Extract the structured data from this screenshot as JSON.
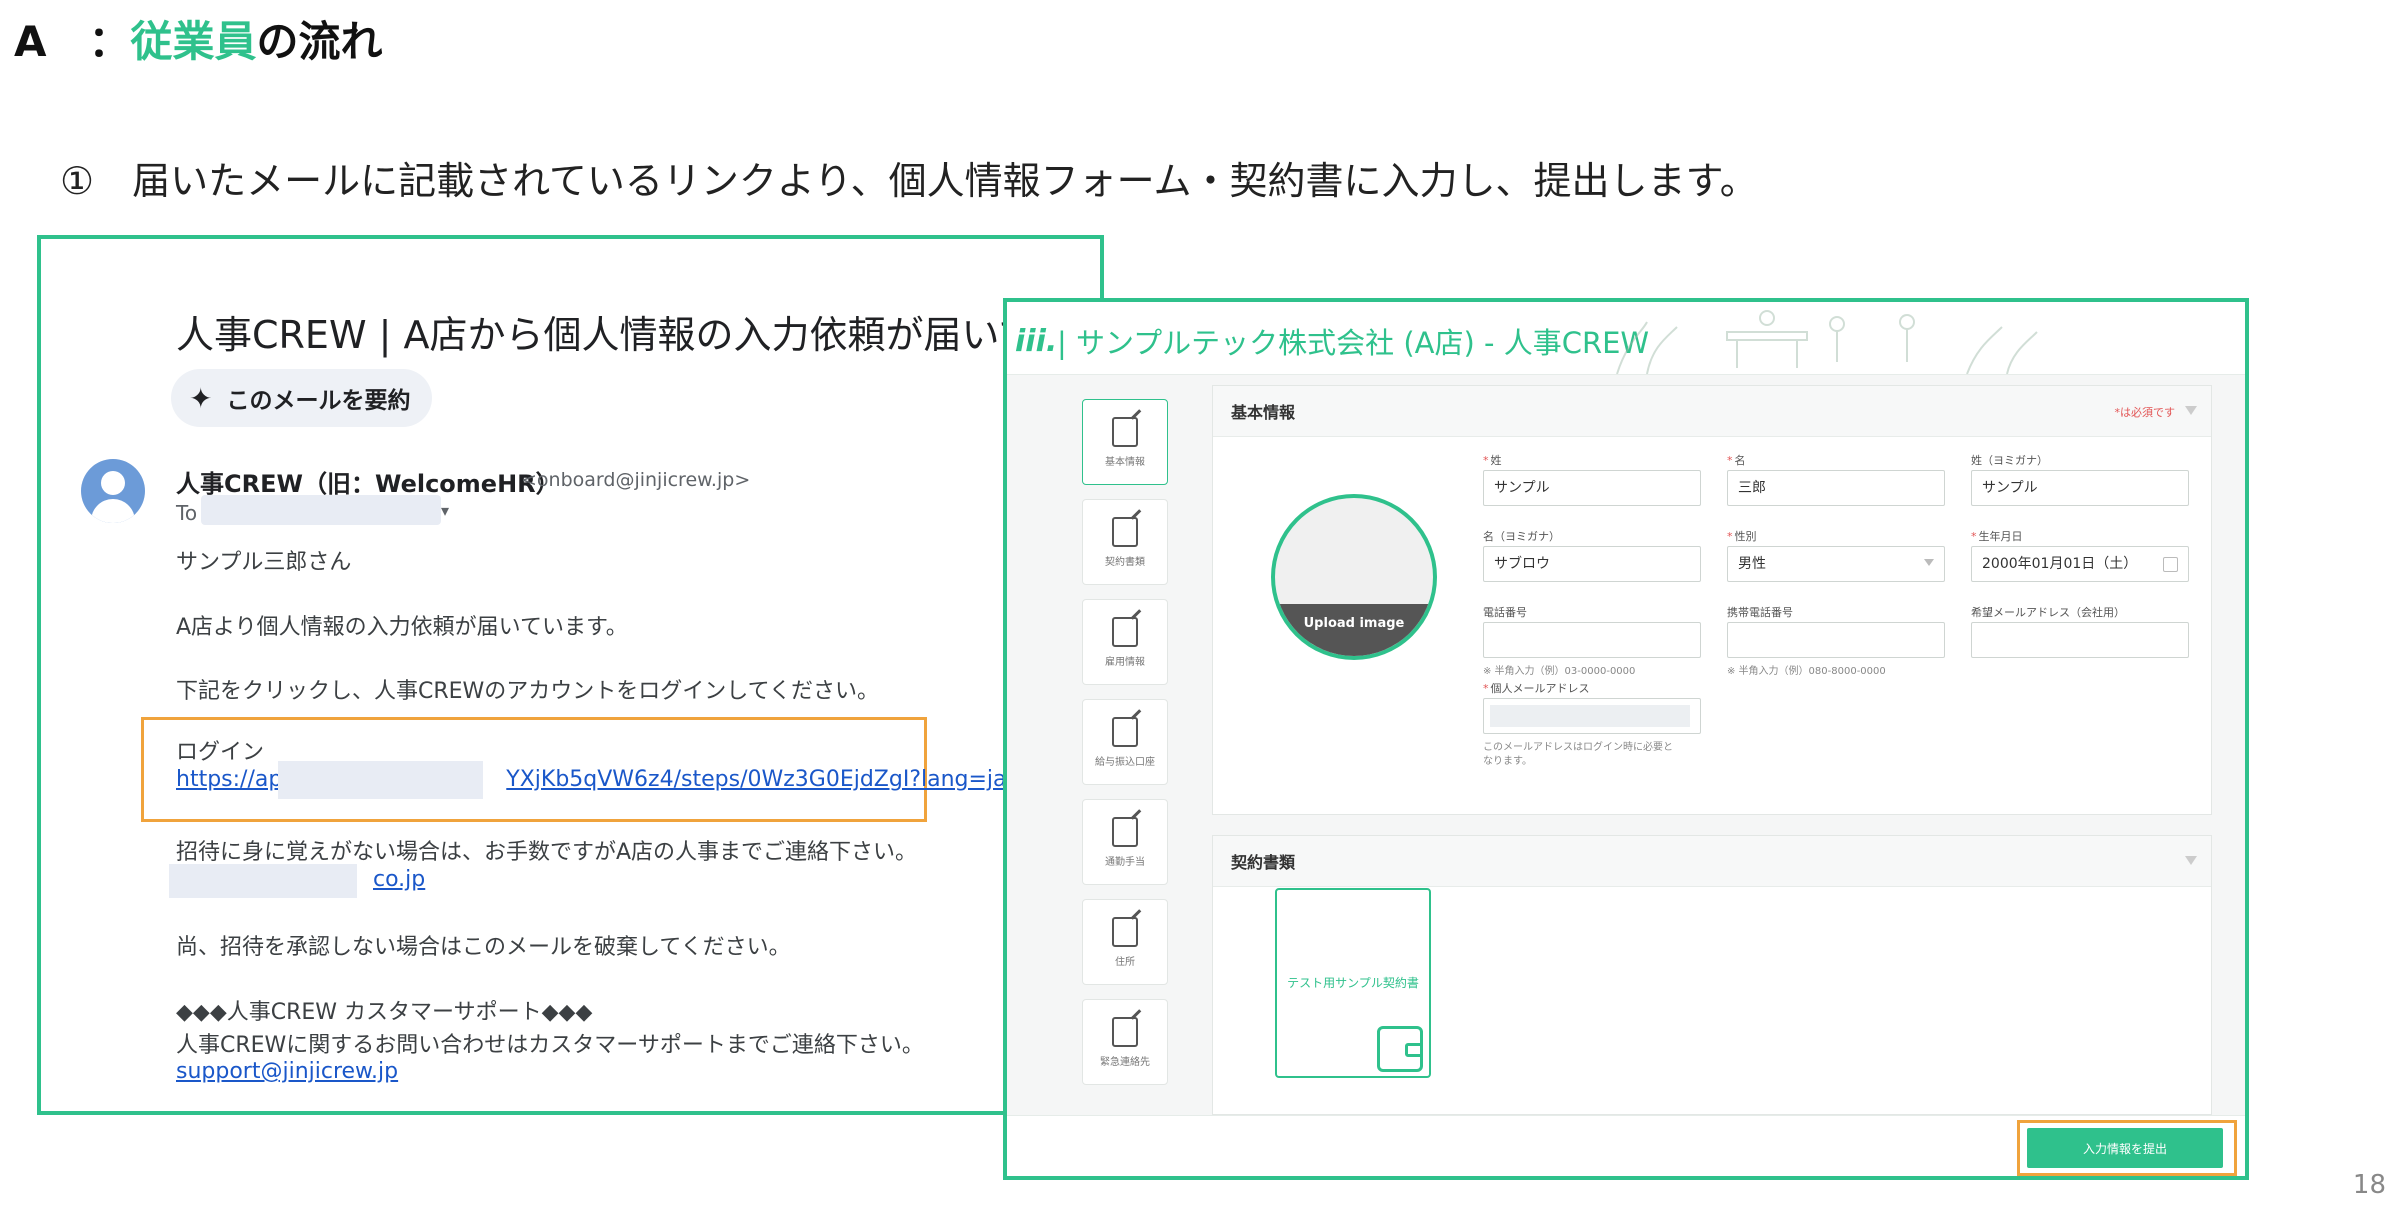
{
  "slide": {
    "title_prefix": "A　：",
    "title_highlight": "従業員",
    "title_suffix": "の流れ",
    "step_text": "①　届いたメールに記載されているリンクより、個人情報フォーム・契約書に入力し、提出します。",
    "page_number": "18"
  },
  "email": {
    "subject": "人事CREW | A店から個人情報の入力依頼が届いています",
    "summarize_label": "このメールを要約",
    "sender_name": "人事CREW（旧：WelcomeHR）",
    "sender_address": "<onboard@jinjicrew.jp>",
    "to_label": "To",
    "greeting": "サンプル三郎さん",
    "line1": "A店より個人情報の入力依頼が届いています。",
    "line2": "下記をクリックし、人事CREWのアカウントをログインしてください。",
    "login_label": "ログイン",
    "login_link_start": "https://app",
    "login_link_end": "YXjKb5qVW6z4/steps/0Wz3G0EjdZgI?lang=ja",
    "invite_line": "招待に身に覚えがない場合は、お手数ですがA店の人事までご連絡下さい。",
    "contact_domain": "co.jp",
    "decline_line": "尚、招待を承認しない場合はこのメールを破棄してください。",
    "support_title": "◆◆◆人事CREW カスタマーサポート◆◆◆",
    "support_line": "人事CREWに関するお問い合わせはカスタマーサポートまでご連絡下さい。",
    "support_link": "support@jinjicrew.jp"
  },
  "app": {
    "logo": "iii.",
    "title": "| サンプルテック株式会社 (A店) - 人事CREW",
    "sidebar": [
      {
        "label": "基本情報",
        "icon": "edit-icon"
      },
      {
        "label": "契約書類",
        "icon": "document-icon"
      },
      {
        "label": "雇用情報",
        "icon": "edit-icon"
      },
      {
        "label": "給与振込口座",
        "icon": "edit-icon"
      },
      {
        "label": "通勤手当",
        "icon": "edit-icon"
      },
      {
        "label": "住所",
        "icon": "edit-icon"
      },
      {
        "label": "緊急連絡先",
        "icon": "edit-icon"
      }
    ],
    "basic_section": {
      "title": "基本情報",
      "required_note": "*は必須です",
      "upload_label": "Upload image",
      "fields": {
        "last_name_label": "姓",
        "last_name_value": "サンプル",
        "first_name_label": "名",
        "first_name_value": "三郎",
        "last_kana_label": "姓（ヨミガナ）",
        "last_kana_value": "サンプル",
        "first_kana_label": "名（ヨミガナ）",
        "first_kana_value": "サブロウ",
        "gender_label": "性別",
        "gender_value": "男性",
        "birth_label": "生年月日",
        "birth_value": "2000年01月01日（土）",
        "phone_label": "電話番号",
        "phone_hint": "※ 半角入力（例）03-0000-0000",
        "mobile_label": "携帯電話番号",
        "mobile_hint": "※ 半角入力（例）080-8000-0000",
        "work_email_label": "希望メールアドレス（会社用）",
        "personal_email_label": "個人メールアドレス",
        "personal_email_hint_1": "このメールアドレスはログイン時に必要と",
        "personal_email_hint_2": "なります。"
      }
    },
    "contract_section": {
      "title": "契約書類",
      "document_name": "テスト用サンプル契約書"
    },
    "submit_label": "入力情報を提出"
  }
}
